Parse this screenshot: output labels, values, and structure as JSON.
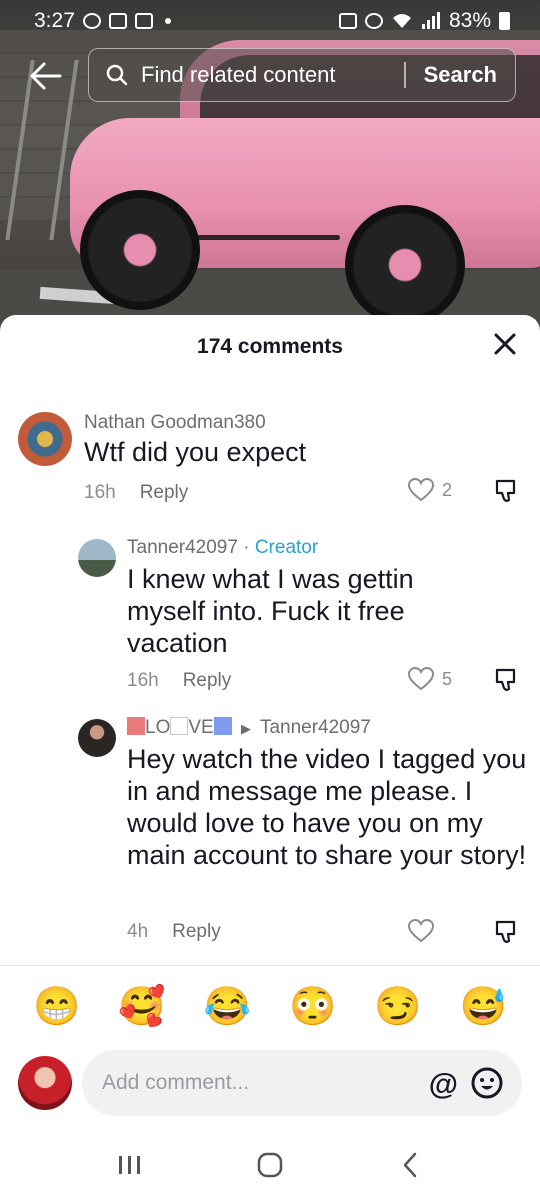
{
  "status_bar": {
    "time": "3:27",
    "battery": "83%"
  },
  "search": {
    "placeholder": "Find related content",
    "button_label": "Search"
  },
  "sheet": {
    "title": "174 comments"
  },
  "comments": [
    {
      "author": "Nathan Goodman380",
      "text": "Wtf did you expect",
      "time": "16h",
      "reply_label": "Reply",
      "likes": "2"
    },
    {
      "author": "Tanner42097",
      "separator": "·",
      "tag": "Creator",
      "text": "I knew what I was gettin myself into. Fuck it free vacation",
      "time": "16h",
      "reply_label": "Reply",
      "likes": "5"
    },
    {
      "author_part1": "LO",
      "author_part2": "VE",
      "reply_to": "Tanner42097",
      "text": "Hey watch the video I tagged you in and message me please. I would love to have you on my main account to share your story!",
      "time": "4h",
      "reply_label": "Reply",
      "likes": ""
    }
  ],
  "emojis": [
    "😁",
    "🥰",
    "😂",
    "😳",
    "😏",
    "😅"
  ],
  "composer": {
    "placeholder": "Add comment...",
    "at_symbol": "@"
  },
  "icons": {
    "back": "arrow-left-icon",
    "search": "search-icon",
    "close": "close-icon",
    "like": "heart-icon",
    "dislike": "thumb-down-icon",
    "emoji": "smile-icon",
    "nav_recents": "recents-icon",
    "nav_home": "home-icon",
    "nav_back": "back-chevron-icon"
  }
}
